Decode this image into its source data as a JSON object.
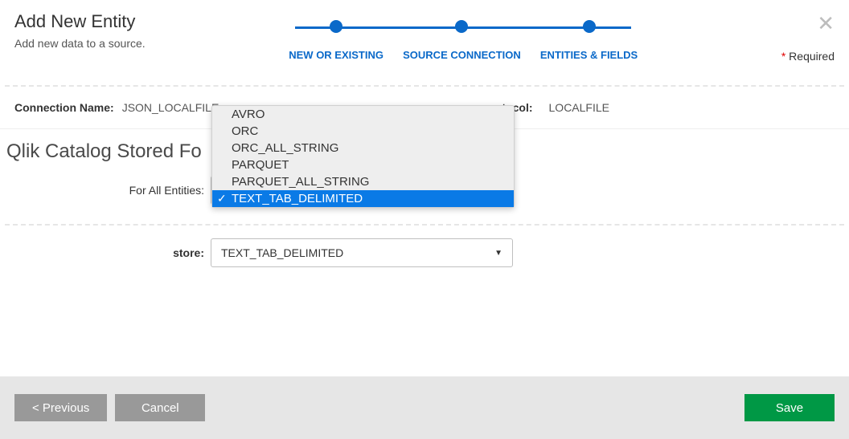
{
  "header": {
    "title": "Add New Entity",
    "subtitle": "Add new data to a source.",
    "required_label": "Required"
  },
  "stepper": {
    "steps": [
      {
        "label": "NEW OR EXISTING"
      },
      {
        "label": "SOURCE CONNECTION"
      },
      {
        "label": "ENTITIES & FIELDS"
      }
    ]
  },
  "connection": {
    "name_label": "Connection Name:",
    "name_value": "JSON_LOCALFILE_",
    "protocol_label_suffix": "rotocol:",
    "protocol_value": "LOCALFILE"
  },
  "section": {
    "title": "Qlik Catalog Stored Fo"
  },
  "form": {
    "all_entities_label": "For All Entities:",
    "store_label": "store:",
    "store_value": "TEXT_TAB_DELIMITED"
  },
  "dropdown": {
    "options": [
      "AVRO",
      "ORC",
      "ORC_ALL_STRING",
      "PARQUET",
      "PARQUET_ALL_STRING",
      "TEXT_TAB_DELIMITED"
    ],
    "selected_index": 5
  },
  "footer": {
    "previous": "< Previous",
    "cancel": "Cancel",
    "save": "Save"
  }
}
